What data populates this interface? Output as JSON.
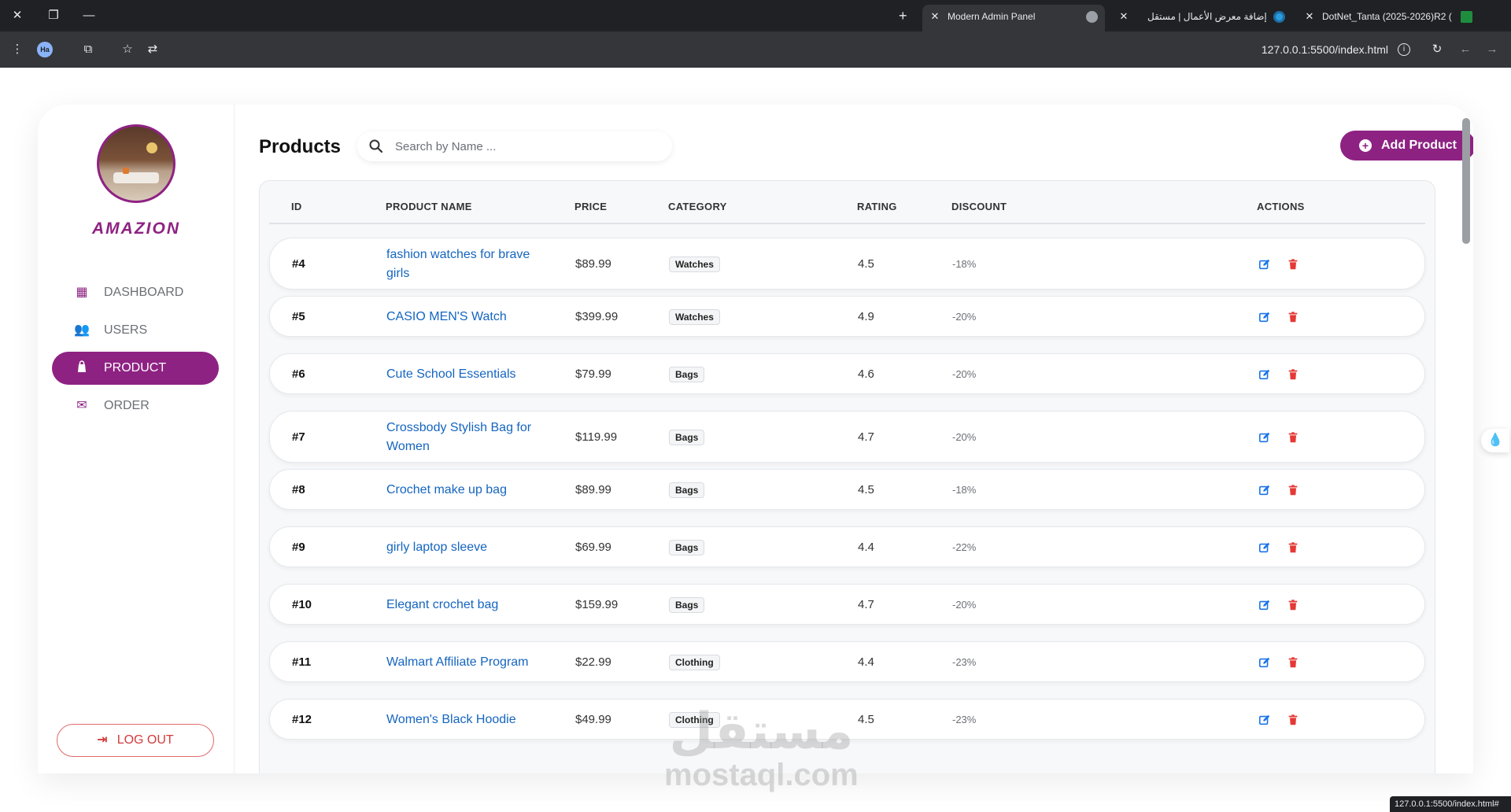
{
  "browser": {
    "tabs": [
      {
        "title": "DotNet_Tanta (2025-2026)R2 (",
        "active": false
      },
      {
        "title": "إضافة معرض الأعمال | مستقل",
        "active": false
      },
      {
        "title": "Modern Admin Panel",
        "active": true
      }
    ],
    "profile_initials": "Ha",
    "address": "127.0.0.1:5500/index.html",
    "status_url": "127.0.0.1:5500/index.html#"
  },
  "sidebar": {
    "brand": "AMAZION",
    "items": [
      {
        "label": "DASHBOARD",
        "icon": "dashboard-icon",
        "active": false
      },
      {
        "label": "USERS",
        "icon": "users-icon",
        "active": false
      },
      {
        "label": "PRODUCT",
        "icon": "bag-icon",
        "active": true
      },
      {
        "label": "ORDER",
        "icon": "envelope-icon",
        "active": false
      }
    ],
    "logout_label": "LOG OUT"
  },
  "main": {
    "title": "Products",
    "search_placeholder": "Search by Name ...",
    "add_button_label": "Add Product",
    "columns": [
      "ID",
      "PRODUCT NAME",
      "PRICE",
      "CATEGORY",
      "RATING",
      "DISCOUNT",
      "ACTIONS"
    ],
    "rows": [
      {
        "id": "#4",
        "name": "fashion watches for brave girls",
        "price": "$89.99",
        "category": "Watches",
        "rating": "4.5",
        "discount": "-18%"
      },
      {
        "id": "#5",
        "name": "CASIO MEN'S Watch",
        "price": "$399.99",
        "category": "Watches",
        "rating": "4.9",
        "discount": "-20%"
      },
      {
        "id": "#6",
        "name": "Cute School Essentials",
        "price": "$79.99",
        "category": "Bags",
        "rating": "4.6",
        "discount": "-20%"
      },
      {
        "id": "#7",
        "name": "Crossbody Stylish Bag for Women",
        "price": "$119.99",
        "category": "Bags",
        "rating": "4.7",
        "discount": "-20%"
      },
      {
        "id": "#8",
        "name": "Crochet make up bag",
        "price": "$89.99",
        "category": "Bags",
        "rating": "4.5",
        "discount": "-18%"
      },
      {
        "id": "#9",
        "name": "girly laptop sleeve",
        "price": "$69.99",
        "category": "Bags",
        "rating": "4.4",
        "discount": "-22%"
      },
      {
        "id": "#10",
        "name": "Elegant crochet bag",
        "price": "$159.99",
        "category": "Bags",
        "rating": "4.7",
        "discount": "-20%"
      },
      {
        "id": "#11",
        "name": "Walmart Affiliate Program",
        "price": "$22.99",
        "category": "Clothing",
        "rating": "4.4",
        "discount": "-23%"
      },
      {
        "id": "#12",
        "name": "Women's Black Hoodie",
        "price": "$49.99",
        "category": "Clothing",
        "rating": "4.5",
        "discount": "-23%"
      }
    ]
  },
  "watermark": {
    "arabic": "مستقل",
    "latin": "mostaql.com"
  },
  "colors": {
    "accent": "#8e2283",
    "link": "#1565c0",
    "edit": "#1a73e8",
    "delete": "#e53935"
  }
}
